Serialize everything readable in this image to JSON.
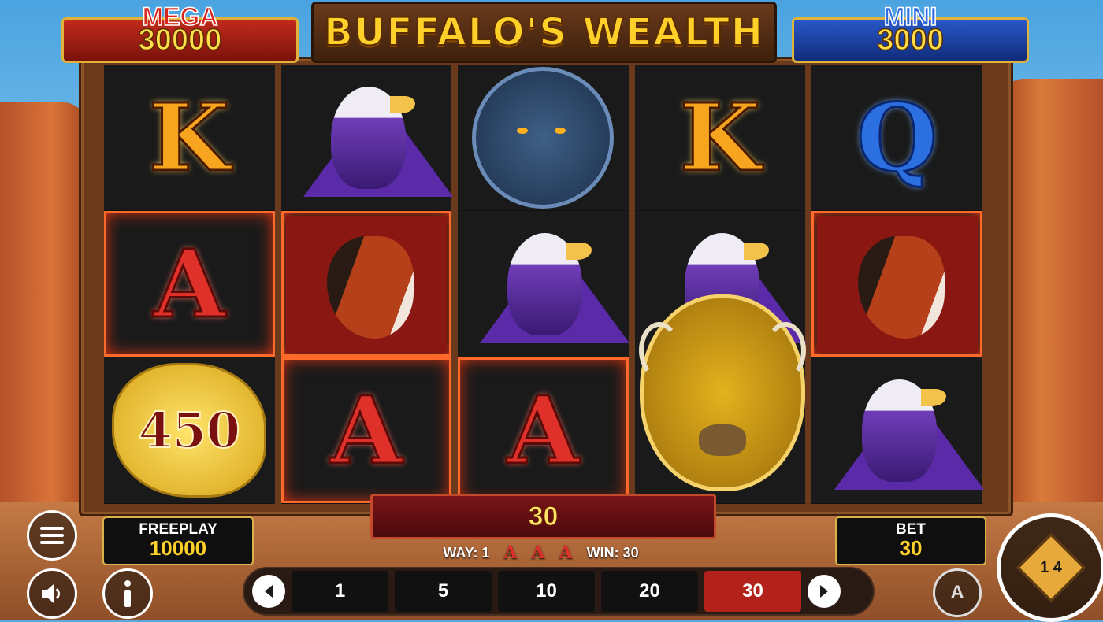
{
  "game": {
    "title": "BUFFALO'S WEALTH"
  },
  "jackpots": {
    "mega": {
      "label": "MEGA",
      "value": "30000",
      "color": "#c32a1c"
    },
    "mini": {
      "label": "MINI",
      "value": "3000",
      "color": "#2a58c8"
    }
  },
  "reels": [
    [
      {
        "type": "letter",
        "symbol": "K",
        "style": "k"
      },
      {
        "type": "letter",
        "symbol": "A",
        "style": "a",
        "win": true
      },
      {
        "type": "nugget",
        "symbol": "450"
      }
    ],
    [
      {
        "type": "eagle"
      },
      {
        "type": "horse",
        "win": true
      },
      {
        "type": "letter",
        "symbol": "A",
        "style": "a",
        "win": true
      }
    ],
    [
      {
        "type": "panther"
      },
      {
        "type": "eagle"
      },
      {
        "type": "letter",
        "symbol": "A",
        "style": "a",
        "win": true
      }
    ],
    [
      {
        "type": "letter",
        "symbol": "K",
        "style": "k"
      },
      {
        "type": "eagle"
      },
      {
        "type": "buffalo"
      }
    ],
    [
      {
        "type": "letter",
        "symbol": "Q",
        "style": "q"
      },
      {
        "type": "horse",
        "win": true
      },
      {
        "type": "eagle"
      }
    ]
  ],
  "win_banner": {
    "amount": "30"
  },
  "win_info": {
    "way": "WAY: 1",
    "symbols": [
      "A",
      "A",
      "A"
    ],
    "win": "WIN: 30"
  },
  "freeplay": {
    "label": "FREEPLAY",
    "value": "10000"
  },
  "bet": {
    "label": "BET",
    "value": "30"
  },
  "bet_options": [
    {
      "value": "1",
      "selected": false
    },
    {
      "value": "5",
      "selected": false
    },
    {
      "value": "10",
      "selected": false
    },
    {
      "value": "20",
      "selected": false
    },
    {
      "value": "30",
      "selected": true
    }
  ],
  "icons": {
    "menu": "menu-icon",
    "sound": "speaker-icon",
    "info": "info-icon",
    "prev": "chevron-left-icon",
    "next": "chevron-right-icon",
    "auto": "autoplay-icon",
    "spin": "spin-icon"
  },
  "spin_button": {
    "badge": "1 4"
  },
  "auto_button": {
    "label": "A"
  },
  "colors": {
    "accent": "#ffd02a",
    "selected_bet": "#b3221a",
    "win_frame": "#ff6a2a"
  }
}
